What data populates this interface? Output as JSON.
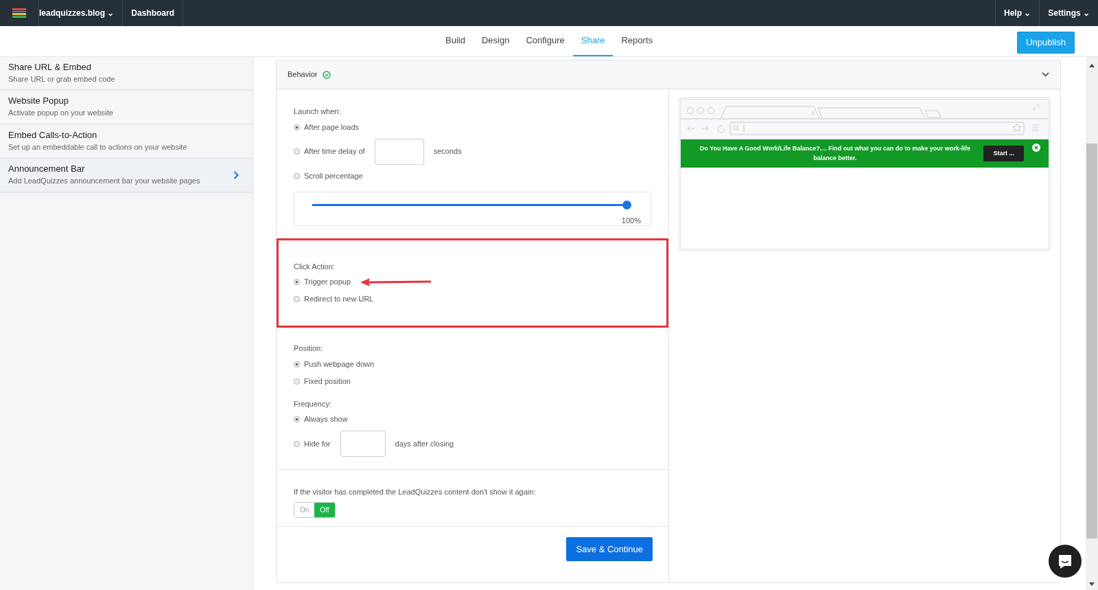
{
  "topbar": {
    "brand": "leadquizzes.blog",
    "brand_caret": "⌄",
    "links": [
      "Dashboard"
    ],
    "right_menus": [
      {
        "label": "Help",
        "caret": "⌄"
      },
      {
        "label": "Settings",
        "caret": "⌄"
      }
    ]
  },
  "tabs": [
    {
      "label": "Build",
      "selected": false
    },
    {
      "label": "Design",
      "selected": false
    },
    {
      "label": "Configure",
      "selected": false
    },
    {
      "label": "Share",
      "selected": true
    },
    {
      "label": "Reports",
      "selected": false
    }
  ],
  "unpublish_button": "Unpublish",
  "sidebar": {
    "items": [
      {
        "title": "Share URL & Embed",
        "subtitle": "Share URL or grab embed code",
        "selected": false
      },
      {
        "title": "Website Popup",
        "subtitle": "Activate popup on your website",
        "selected": false
      },
      {
        "title": "Embed Calls-to-Action",
        "subtitle": "Set up an embeddable call to actions on your website",
        "selected": false
      },
      {
        "title": "Announcement Bar",
        "subtitle": "Add LeadQuizzes announcement bar your website pages",
        "selected": true
      }
    ]
  },
  "panel": {
    "title": "Behavior",
    "complete": true,
    "expanded": true,
    "groups": [
      {
        "label": "Launch when:",
        "highlighted": false,
        "options": [
          {
            "kind": "plain",
            "label": "After page loads",
            "selected": true
          },
          {
            "kind": "input",
            "label": "After time delay of",
            "suffix": "seconds",
            "selected": false
          },
          {
            "kind": "plain",
            "label": "Scroll percentage",
            "selected": false
          }
        ],
        "slider": {
          "level": 1,
          "reading": "100%"
        }
      },
      {
        "label": "Click Action:",
        "highlighted": true,
        "options": [
          {
            "kind": "plain",
            "label": "Trigger popup",
            "selected": true
          },
          {
            "kind": "plain",
            "label": "Redirect to new URL",
            "selected": false
          }
        ]
      },
      {
        "label": "Position:",
        "highlighted": false,
        "options": [
          {
            "kind": "plain",
            "label": "Push webpage down",
            "selected": true
          },
          {
            "kind": "plain",
            "label": "Fixed position",
            "selected": false
          }
        ]
      },
      {
        "label": "Frequency:",
        "highlighted": false,
        "options": [
          {
            "kind": "plain",
            "label": "Always show",
            "selected": true
          },
          {
            "kind": "input",
            "label": "Hide for",
            "suffix": "days after closing",
            "selected": false
          }
        ]
      }
    ],
    "completed_rule": {
      "label": "If the visitor has completed the LeadQuizzes content don't show it again:",
      "on_label": "On",
      "off_label": "Off",
      "on": false
    },
    "save_button": "Save & Continue",
    "preview": {
      "banner_text": "Do You Have A Good Work/Life Balance?.... Find out what you can do to make your work-life balance better.",
      "banner_button": "Start ..."
    }
  }
}
